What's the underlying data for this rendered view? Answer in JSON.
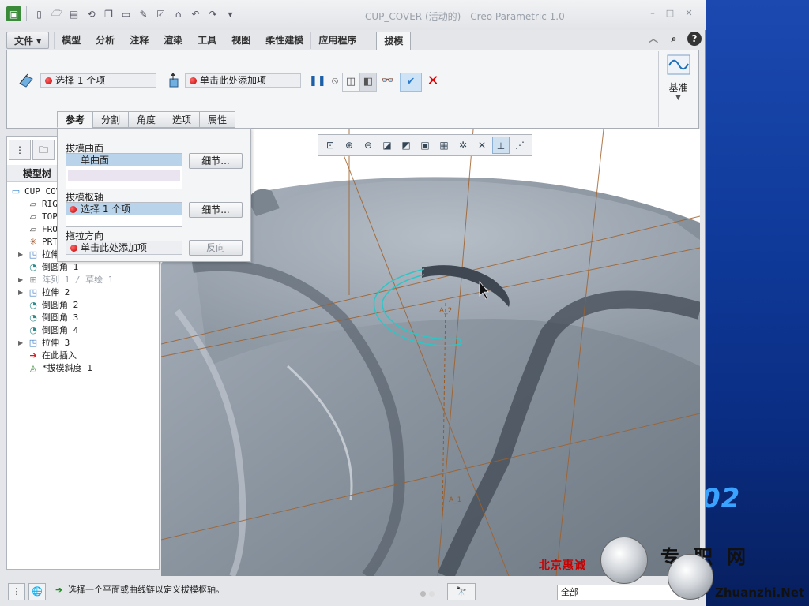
{
  "window": {
    "title": "CUP_COVER (活动的) - Creo Parametric 1.0",
    "controls": [
      "–",
      "□",
      "✕"
    ]
  },
  "ribbon": {
    "file_label": "文件 ▾",
    "tabs": [
      "模型",
      "分析",
      "注释",
      "渲染",
      "工具",
      "视图",
      "柔性建模",
      "应用程序"
    ],
    "active_tab": "拔模",
    "draft_surfaces_field": "选择 1 个项",
    "draft_hinges_field": "单击此处添加项",
    "datum_label": "基准"
  },
  "dashboard_tabs": [
    "参考",
    "分割",
    "角度",
    "选项",
    "属性"
  ],
  "references_panel": {
    "draft_surfaces_label": "拔模曲面",
    "draft_surfaces_items": [
      "单曲面"
    ],
    "draft_hinges_label": "拔模枢轴",
    "draft_hinges_items": [
      "选择 1 个项"
    ],
    "pull_direction_label": "拖拉方向",
    "pull_direction_value": "单击此处添加项",
    "details_label": "细节...",
    "flip_label": "反向"
  },
  "model_tree": {
    "header": "模型树",
    "items": [
      {
        "label": "CUP_COV",
        "icon": "part-icon",
        "grey": false,
        "indent": 0
      },
      {
        "label": "RIG",
        "icon": "datum-plane-icon",
        "grey": false,
        "indent": 1
      },
      {
        "label": "TOP",
        "icon": "datum-plane-icon",
        "grey": false,
        "indent": 1
      },
      {
        "label": "FRO",
        "icon": "datum-plane-icon",
        "grey": false,
        "indent": 1
      },
      {
        "label": "PRT",
        "icon": "coord-sys-icon",
        "grey": false,
        "indent": 1
      },
      {
        "label": "拉伸",
        "icon": "extrude-icon",
        "grey": false,
        "indent": 1,
        "expand": true
      },
      {
        "label": "倒圆角 1",
        "icon": "round-icon",
        "grey": false,
        "indent": 1
      },
      {
        "label": "阵列 1 / 草绘 1",
        "icon": "pattern-icon",
        "grey": true,
        "indent": 1,
        "expand": true
      },
      {
        "label": "拉伸 2",
        "icon": "extrude-icon",
        "grey": false,
        "indent": 1,
        "expand": true
      },
      {
        "label": "倒圆角 2",
        "icon": "round-icon",
        "grey": false,
        "indent": 1
      },
      {
        "label": "倒圆角 3",
        "icon": "round-icon",
        "grey": false,
        "indent": 1
      },
      {
        "label": "倒圆角 4",
        "icon": "round-icon",
        "grey": false,
        "indent": 1
      },
      {
        "label": "拉伸 3",
        "icon": "extrude-icon",
        "grey": false,
        "indent": 1,
        "expand": true
      },
      {
        "label": "在此插入",
        "icon": "insert-arrow-icon",
        "grey": false,
        "indent": 1
      },
      {
        "label": "*拔模斜度 1",
        "icon": "draft-icon",
        "grey": false,
        "indent": 1
      }
    ]
  },
  "graphics": {
    "datum_labels": [
      "A_2",
      "A_1"
    ]
  },
  "status_bar": {
    "message": "选择一个平面或曲线链以定义拔模枢轴。",
    "filter_value": "全部"
  },
  "watermark": {
    "chinese": "专职网",
    "site": "Zhuanzhi.Net",
    "red_text": "北京惠诚"
  },
  "desktop_number": "02"
}
